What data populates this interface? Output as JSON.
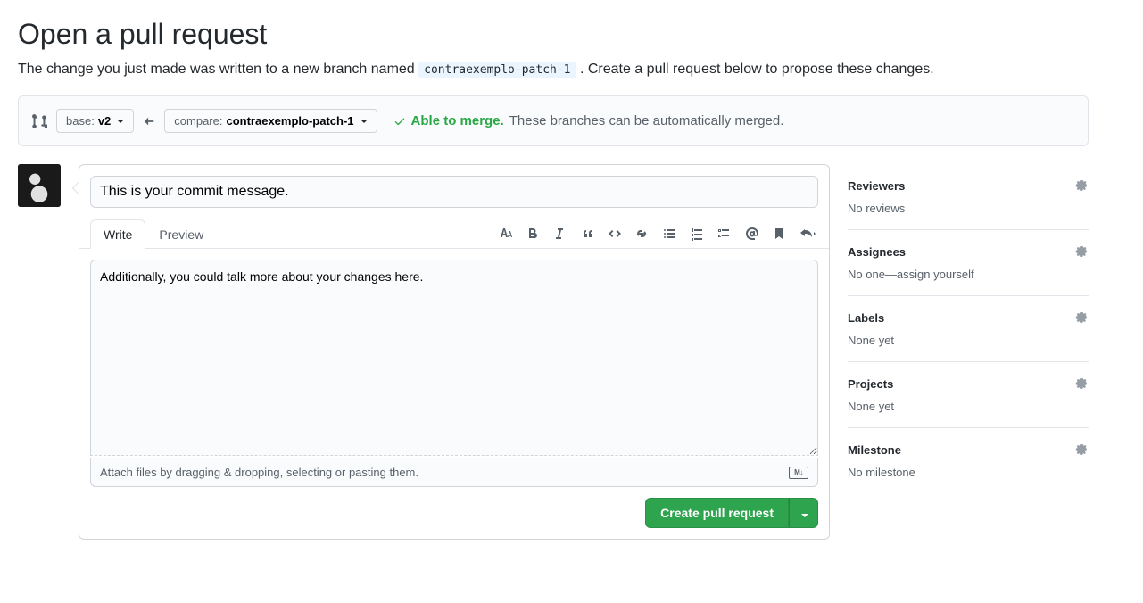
{
  "page": {
    "title": "Open a pull request",
    "subtitle_before": "The change you just made was written to a new branch named ",
    "branch_code": "contraexemplo-patch-1",
    "subtitle_after": ". Create a pull request below to propose these changes."
  },
  "compare": {
    "base_label": "base: ",
    "base_value": "v2",
    "compare_label": "compare: ",
    "compare_value": "contraexemplo-patch-1",
    "merge_able": "Able to merge.",
    "merge_detail": "These branches can be automatically merged."
  },
  "form": {
    "title_value": "This is your commit message.",
    "tabs": {
      "write": "Write",
      "preview": "Preview"
    },
    "body_value": "Additionally, you could talk more about your changes here.",
    "attach_hint": "Attach files by dragging & dropping, selecting or pasting them.",
    "submit_label": "Create pull request"
  },
  "sidebar": {
    "reviewers": {
      "title": "Reviewers",
      "value": "No reviews"
    },
    "assignees": {
      "title": "Assignees",
      "value_prefix": "No one—",
      "assign_self": "assign yourself"
    },
    "labels": {
      "title": "Labels",
      "value": "None yet"
    },
    "projects": {
      "title": "Projects",
      "value": "None yet"
    },
    "milestone": {
      "title": "Milestone",
      "value": "No milestone"
    }
  }
}
